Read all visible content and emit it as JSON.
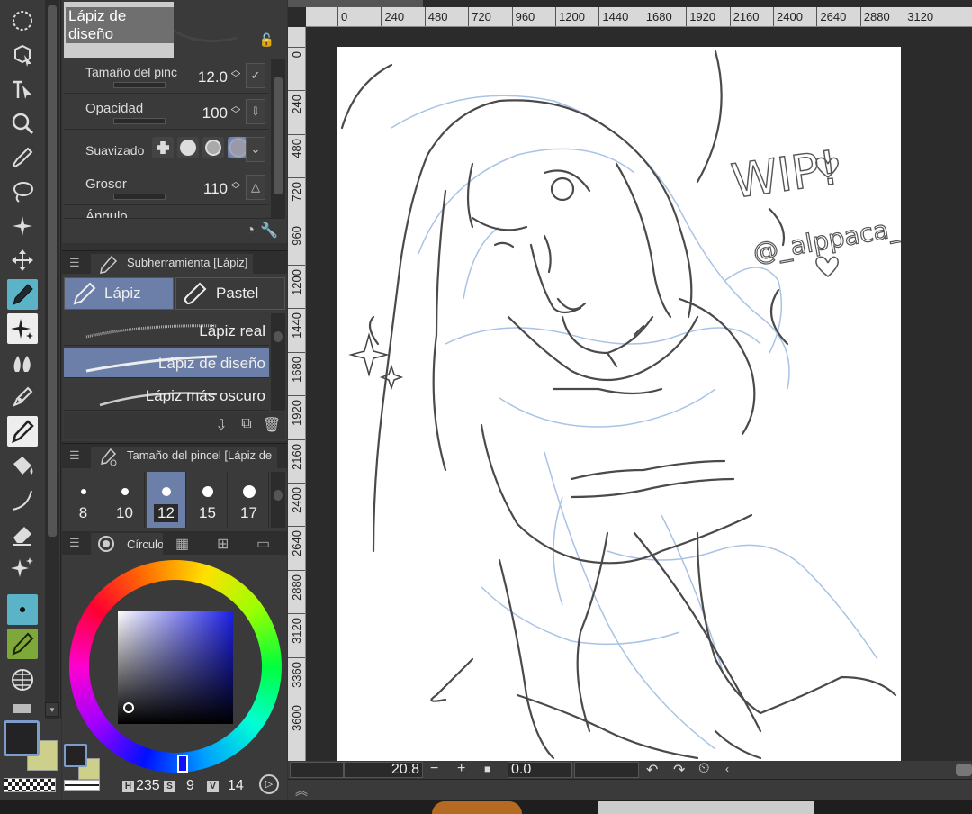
{
  "tool_property": {
    "title": "Lápiz de diseño",
    "rows": [
      {
        "label": "Tamaño del pinc",
        "value": "12.0"
      },
      {
        "label": "Opacidad",
        "value": "100"
      },
      {
        "label": "Suavizado",
        "value": ""
      },
      {
        "label": "Grosor",
        "value": "110"
      },
      {
        "label": "Ángulo",
        "value": ""
      }
    ]
  },
  "subtool": {
    "header": "Subherramienta [Lápiz]",
    "groups": [
      "Lápiz",
      "Pastel"
    ],
    "brushes": [
      "Lápiz real",
      "Lápiz de diseño",
      "Lápiz más oscuro"
    ]
  },
  "brush_size": {
    "header": "Tamaño del pincel [Lápiz de",
    "sizes": [
      "8",
      "10",
      "12",
      "15",
      "17"
    ]
  },
  "color_panel": {
    "tab": "Círculo",
    "h_label": "H",
    "h": "235",
    "s_label": "S",
    "s": "9",
    "v_label": "V",
    "v": "14",
    "main_color": "#232326",
    "sub_color": "#cdd08a"
  },
  "ruler": {
    "top": [
      "0",
      "240",
      "480",
      "720",
      "960",
      "1200",
      "1440",
      "1680",
      "1920",
      "2160",
      "2400",
      "2640",
      "2880",
      "3120"
    ],
    "left": [
      "0",
      "240",
      "480",
      "720",
      "960",
      "1200",
      "1440",
      "1680",
      "1920",
      "2160",
      "2400",
      "2640",
      "2880",
      "3120",
      "3360",
      "3600"
    ]
  },
  "canvas_text": {
    "wip": "WIP!",
    "handle": "@_alppaca_"
  },
  "navigator": {
    "zoom": "20.8",
    "angle": "0.0"
  },
  "icons": [
    "select-rotate-icon",
    "object-icon",
    "operation-icon",
    "zoom-icon",
    "eyedropper-icon",
    "lasso-icon",
    "auto-select-icon",
    "move-icon",
    "pen-icon",
    "decoration-sparkle-icon",
    "blend-icon",
    "vector-pen-icon",
    "pencil-icon",
    "fill-icon",
    "curve-icon",
    "eraser-icon",
    "sparkle-icon",
    "dot-pen-icon",
    "green-pen-icon",
    "grid-icon"
  ]
}
